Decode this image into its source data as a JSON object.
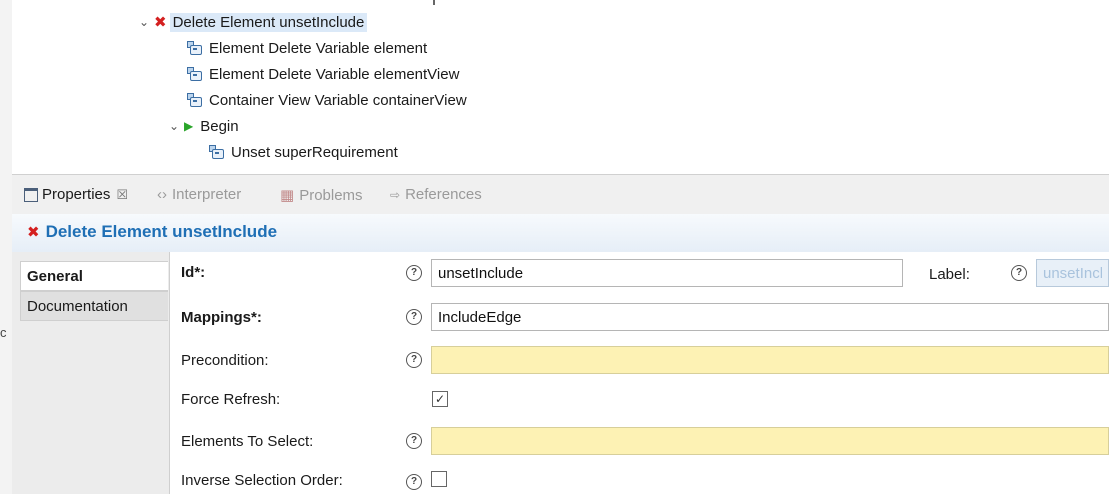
{
  "tree": {
    "items": [
      {
        "label": "Delete Element unsetInclude",
        "icon": "delete-x-icon",
        "expanded": true,
        "selected": true
      },
      {
        "label": "Element Delete Variable element",
        "icon": "variable-icon"
      },
      {
        "label": "Element Delete Variable elementView",
        "icon": "variable-icon"
      },
      {
        "label": "Container View Variable containerView",
        "icon": "variable-icon"
      },
      {
        "label": "Begin",
        "icon": "begin-play-icon",
        "expanded": true
      },
      {
        "label": "Unset superRequirement",
        "icon": "variable-icon"
      }
    ]
  },
  "tabs": [
    {
      "label": "Properties",
      "active": true,
      "close": "☒"
    },
    {
      "label": "Interpreter",
      "active": false
    },
    {
      "label": "Problems",
      "active": false
    },
    {
      "label": "References",
      "active": false
    }
  ],
  "properties": {
    "title": "Delete Element unsetInclude",
    "side_tabs": [
      "General",
      "Documentation"
    ],
    "fields": {
      "id": {
        "label": "Id*:",
        "value": "unsetInclude"
      },
      "label": {
        "label": "Label:",
        "value": "unsetInclude"
      },
      "mappings": {
        "label": "Mappings*:",
        "value": "IncludeEdge"
      },
      "precondition": {
        "label": "Precondition:",
        "value": ""
      },
      "force_refresh": {
        "label": "Force Refresh:",
        "checked": true
      },
      "elements_to_select": {
        "label": "Elements To Select:",
        "value": ""
      },
      "inverse_selection_order": {
        "label": "Inverse Selection Order:",
        "checked": false
      }
    },
    "help_glyph": "?",
    "check_glyph": "✓"
  },
  "colors": {
    "title_blue": "#1f6fb5",
    "required_yellow": "#fdf2b4",
    "selection": "#dbe9f8",
    "delete_red": "#d42020",
    "begin_green": "#2aa52a"
  },
  "stray_char": "c"
}
